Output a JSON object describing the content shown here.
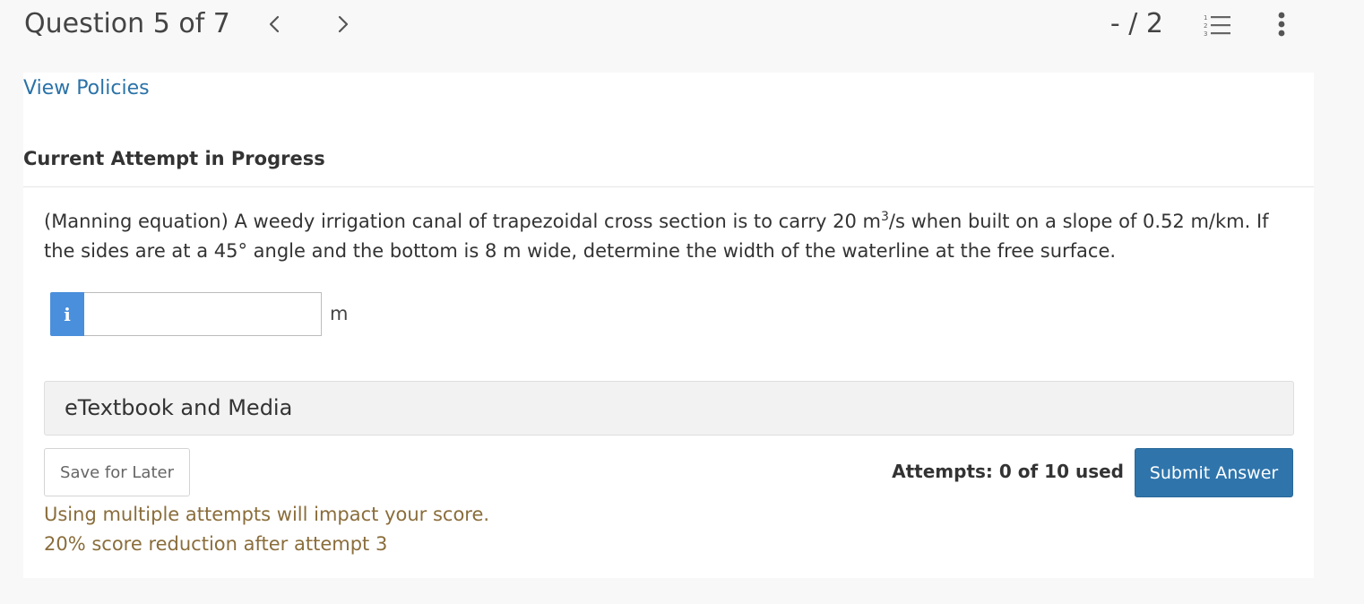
{
  "header": {
    "question_position": "Question 5 of 7",
    "score": "- / 2",
    "icons": {
      "prev": "chevron-left-icon",
      "next": "chevron-right-icon",
      "list": "numbered-list-icon",
      "more": "vertical-ellipsis-icon"
    }
  },
  "policies": {
    "link_label": "View Policies"
  },
  "attempt": {
    "heading": "Current Attempt in Progress"
  },
  "question": {
    "text_part1": "(Manning equation) A weedy irrigation canal of trapezoidal cross section is to carry 20 m",
    "superscript": "3",
    "text_part2": "/s when built on a slope of 0.52 m/km. If the sides are at a 45° angle and the bottom is 8 m wide, determine the width of the waterline at the free surface."
  },
  "answer": {
    "info_badge": "i",
    "value": "",
    "placeholder": "",
    "unit": "m"
  },
  "etextbook": {
    "label": "eTextbook and Media"
  },
  "actions": {
    "save_label": "Save for Later",
    "attempts_text": "Attempts: 0 of 10 used",
    "submit_label": "Submit Answer"
  },
  "warnings": {
    "line1": "Using multiple attempts will impact your score.",
    "line2": "20% score reduction after attempt 3"
  },
  "colors": {
    "link": "#2a72a8",
    "primary_button": "#2f75ac",
    "info_badge": "#4a8fdb",
    "warning_text": "#8a6d3b"
  }
}
